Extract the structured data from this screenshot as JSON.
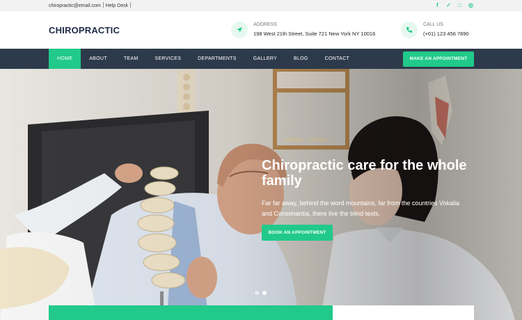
{
  "topbar": {
    "email": "chiropractic@email.com",
    "help": "Help Desk",
    "social_icons": [
      "facebook-icon",
      "twitter-icon",
      "instagram-icon",
      "dribbble-icon"
    ],
    "social_glyphs": [
      "f",
      "✓",
      "□",
      "◎"
    ]
  },
  "header": {
    "brand": "CHIROPRACTIC",
    "address_label": "ADDRESS",
    "address_value": "198 West 21th Street, Suite 721 New York NY 10016",
    "call_label": "CALL US",
    "call_value": "(+01) 123 456 7890"
  },
  "nav": {
    "items": [
      "HOME",
      "ABOUT",
      "TEAM",
      "SERVICES",
      "DEPARTMENTS",
      "GALLERY",
      "BLOG",
      "CONTACT"
    ],
    "cta": "MAKE AN APPOINTMENT"
  },
  "hero": {
    "title": "Chiropractic care for the whole family",
    "text": "Far far away, behind the word mountains, far from the countries Vokalia and Consonantia, there live the blind texts.",
    "button": "BOOK AN APPOINTMENT",
    "slides": 2,
    "active_slide": 2
  },
  "colors": {
    "accent": "#21c98a",
    "nav_bg": "#2d3a4b",
    "brand": "#1e2a45"
  }
}
